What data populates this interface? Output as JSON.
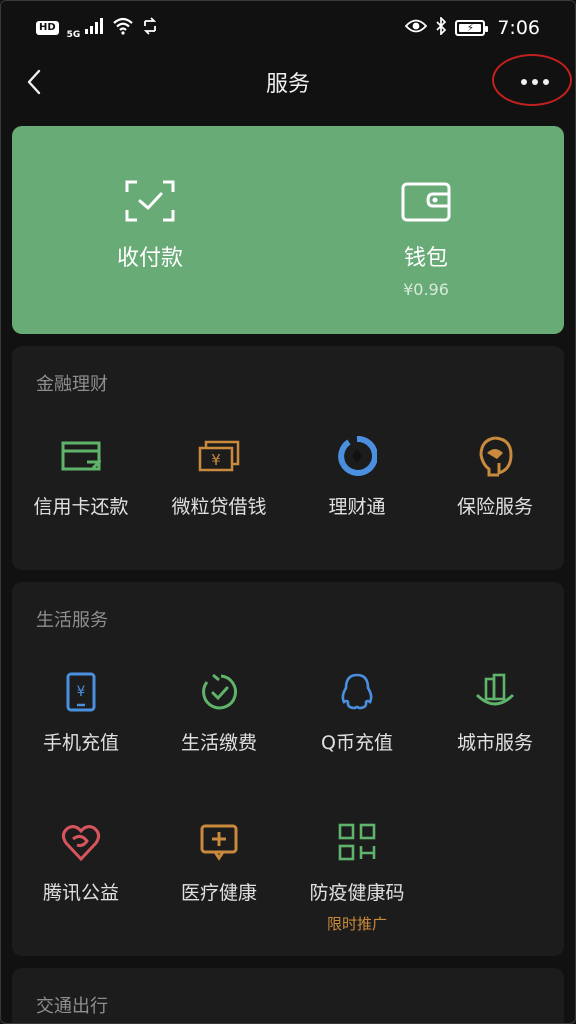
{
  "status_bar": {
    "hd": "HD",
    "network": "5G",
    "time": "7:06"
  },
  "header": {
    "title": "服务",
    "back_icon": "chevron-left-icon",
    "more_icon": "more-horizontal-icon"
  },
  "wallet": {
    "items": [
      {
        "label": "收付款",
        "icon": "scan-pay-icon"
      },
      {
        "label": "钱包",
        "icon": "wallet-icon",
        "balance": "¥0.96"
      }
    ],
    "background": "#69ab77"
  },
  "sections": [
    {
      "title": "金融理财",
      "items": [
        {
          "label": "信用卡还款",
          "icon": "credit-card-icon",
          "color": "#5fb36b"
        },
        {
          "label": "微粒贷借钱",
          "icon": "loan-cash-icon",
          "color": "#c98a3d"
        },
        {
          "label": "理财通",
          "icon": "wealth-icon",
          "color": "#4a8fe0"
        },
        {
          "label": "保险服务",
          "icon": "insurance-icon",
          "color": "#c98a3d"
        }
      ]
    },
    {
      "title": "生活服务",
      "items": [
        {
          "label": "手机充值",
          "icon": "phone-recharge-icon",
          "color": "#4a8fe0"
        },
        {
          "label": "生活缴费",
          "icon": "utility-bill-icon",
          "color": "#5fb36b"
        },
        {
          "label": "Q币充值",
          "icon": "qq-coin-icon",
          "color": "#4a8fe0"
        },
        {
          "label": "城市服务",
          "icon": "city-service-icon",
          "color": "#5fb36b"
        },
        {
          "label": "腾讯公益",
          "icon": "charity-heart-icon",
          "color": "#d9555e"
        },
        {
          "label": "医疗健康",
          "icon": "medical-icon",
          "color": "#c98a3d"
        },
        {
          "label": "防疫健康码",
          "icon": "health-code-icon",
          "color": "#5fb36b",
          "sub": "限时推广"
        }
      ]
    },
    {
      "title": "交通出行",
      "items": []
    }
  ]
}
